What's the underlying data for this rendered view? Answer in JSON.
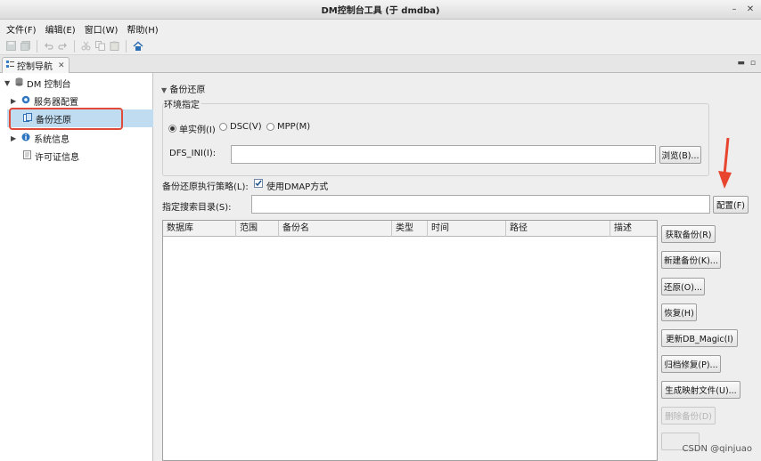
{
  "window": {
    "title": "DM控制台工具 (于 dmdba)"
  },
  "menu": [
    "文件(F)",
    "编辑(E)",
    "窗口(W)",
    "帮助(H)"
  ],
  "view_tab": {
    "label": "控制导航"
  },
  "tree": {
    "root": "DM 控制台",
    "items": [
      "服务器配置",
      "备份还原",
      "系统信息",
      "许可证信息"
    ]
  },
  "section": {
    "title": "备份还原"
  },
  "env": {
    "group_label": "环境指定",
    "radios": [
      "单实例(I)",
      "DSC(V)",
      "MPP(M)"
    ],
    "dfs_label": "DFS_INI(I):",
    "browse_label": "浏览(B)..."
  },
  "strategy": {
    "label": "备份还原执行策略(L):",
    "checkbox_label": "使用DMAP方式",
    "checked": true
  },
  "search_dir": {
    "label": "指定搜索目录(S):",
    "config_label": "配置(F)"
  },
  "table": {
    "columns": [
      "数据库",
      "范围",
      "备份名",
      "类型",
      "时间",
      "路径",
      "描述"
    ]
  },
  "actions": [
    "获取备份(R)",
    "新建备份(K)...",
    "还原(O)...",
    "恢复(H)",
    "更新DB_Magic(I)",
    "归档修复(P)...",
    "生成映射文件(U)...",
    "删除备份(D)"
  ],
  "watermark": "CSDN @qinjuao",
  "colors": {
    "selection": "#bfdcf1",
    "highlight_box": "#e04a3a",
    "arrow": "#e8452f"
  }
}
